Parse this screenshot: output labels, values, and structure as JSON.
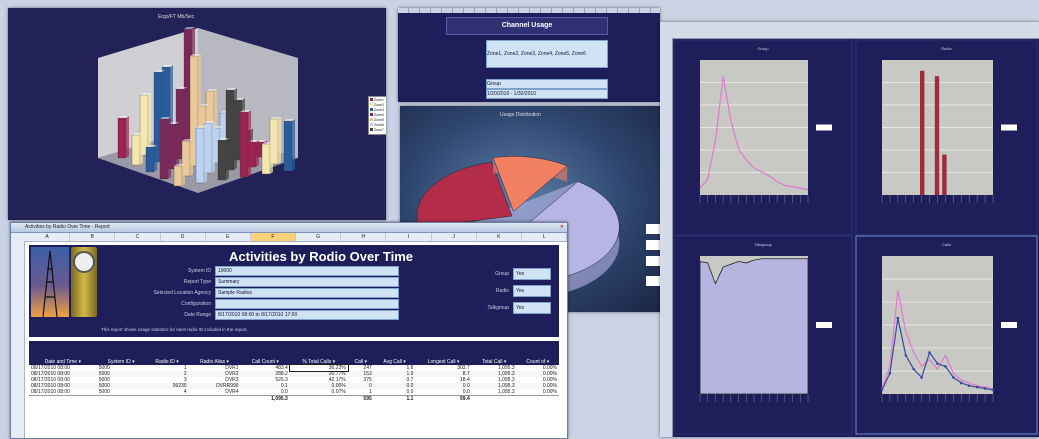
{
  "bar3d": {
    "title": "Ergo/FT Mb/Sec",
    "legend": [
      "Zone1",
      "Zone2",
      "Zone3",
      "Zone4",
      "Zone5",
      "Zone6",
      "Zone7"
    ],
    "colors": [
      "#9b2451",
      "#f5e6b0",
      "#2a5c9a",
      "#7a2a5a",
      "#e9c89a",
      "#bcd3f0",
      "#444444"
    ],
    "heights": [
      [
        40,
        60,
        85,
        120,
        55,
        30
      ],
      [
        30,
        90,
        70,
        50,
        40,
        20
      ],
      [
        25,
        45,
        110,
        35,
        60,
        15
      ],
      [
        60,
        35,
        50,
        80,
        25,
        45
      ],
      [
        20,
        55,
        40,
        65,
        30,
        50
      ]
    ]
  },
  "channel": {
    "title": "Channel Usage",
    "field1_value": "Zone1, Zone2, Zone3, Zone4, Zone5, Zone6",
    "field2_value": "Group",
    "field3_value": "1/20/2010 - 1/30/2010"
  },
  "pie": {
    "title": "Usage Distribution",
    "slices": [
      {
        "value": 62,
        "color": "#b7b5e4"
      },
      {
        "value": 25,
        "color": "#b32d4a"
      },
      {
        "value": 13,
        "color": "#f28062"
      }
    ]
  },
  "activities": {
    "window_title": "Activities by Radio Over Time - Report",
    "title": "Activities by Rodio Over Time",
    "params": [
      {
        "label": "System ID",
        "value": "10000"
      },
      {
        "label": "Report Type",
        "value": "Summary"
      },
      {
        "label": "Selected Location Agency",
        "value": "Sample Radios"
      },
      {
        "label": "Configuration",
        "value": ""
      },
      {
        "label": "Date Range",
        "value": "8/17/2010 08:00 to 8/17/2010 17:00"
      }
    ],
    "right_params": [
      {
        "label": "Group",
        "value": "Yes"
      },
      {
        "label": "Radio",
        "value": "Yes"
      },
      {
        "label": "Talkgroup",
        "value": "Yes"
      }
    ],
    "note": "This report shows usage statistics for each radio ID included in the report.",
    "columns": [
      "Date and Time",
      "System ID",
      "Radio ID",
      "Radio Alias",
      "Call Count",
      "% Total Calls",
      "Call",
      "Avg Call",
      "Longest Call",
      "Total Call",
      "Count of"
    ],
    "col_letters": [
      "A",
      "B",
      "C",
      "D",
      "E",
      "F",
      "G",
      "H",
      "I",
      "J",
      "K",
      "L"
    ],
    "rows": [
      [
        "08/17/2010 08:00",
        "5000",
        "1",
        "DVR1",
        "483.4",
        "36.23%",
        "247",
        "1.6",
        "303.7",
        "1,095.3",
        "0.00%"
      ],
      [
        "08/17/2010 08:00",
        "5000",
        "2",
        "DVR2",
        "288.2",
        "20.77%",
        "153",
        "1.9",
        "8.7",
        "1,095.3",
        "0.00%"
      ],
      [
        "08/17/2010 08:00",
        "5000",
        "3",
        "DVR3",
        "526.3",
        "42.17%",
        "375",
        "0.7",
        "18.4",
        "1,095.3",
        "0.00%"
      ],
      [
        "08/17/2010 08:00",
        "5000",
        "99235",
        "DVRR999",
        "0.1",
        "0.00%",
        "0",
        "0.0",
        "0.0",
        "1,095.3",
        "0.00%"
      ],
      [
        "08/17/2010 08:00",
        "5000",
        "4",
        "DVR4",
        "0.0",
        "0.07%",
        "1",
        "0.0",
        "0.0",
        "1,095.3",
        "0.00%"
      ]
    ],
    "totals": [
      "1,095.3",
      "595",
      "1.1",
      "99.4"
    ]
  },
  "dashboard": {
    "panels": [
      {
        "title": "Group",
        "kind": "line",
        "values": [
          5,
          12,
          40,
          88,
          55,
          34,
          26,
          20,
          17,
          14,
          10,
          7,
          6,
          5,
          4
        ],
        "color": "#e07ad0"
      },
      {
        "title": "Radio",
        "kind": "bar",
        "values": [
          0,
          0,
          0,
          0,
          0,
          92,
          0,
          88,
          30,
          0,
          0,
          0,
          0,
          0,
          0
        ],
        "color": "#9b2d3c"
      },
      {
        "title": "Talkgroup",
        "kind": "area",
        "values": [
          96,
          95,
          80,
          92,
          94,
          96,
          95,
          97,
          98,
          98,
          98,
          98,
          98,
          98,
          98
        ],
        "color": "#b6b5e2"
      },
      {
        "title": "Calls",
        "kind": "line2",
        "values": [
          4,
          20,
          75,
          45,
          30,
          20,
          25,
          18,
          28,
          15,
          10,
          8,
          6,
          5,
          4
        ],
        "values2": [
          3,
          15,
          55,
          28,
          18,
          12,
          30,
          22,
          20,
          12,
          8,
          6,
          5,
          4,
          3
        ],
        "color": "#e07ad0",
        "color2": "#3a4a9a"
      }
    ]
  }
}
